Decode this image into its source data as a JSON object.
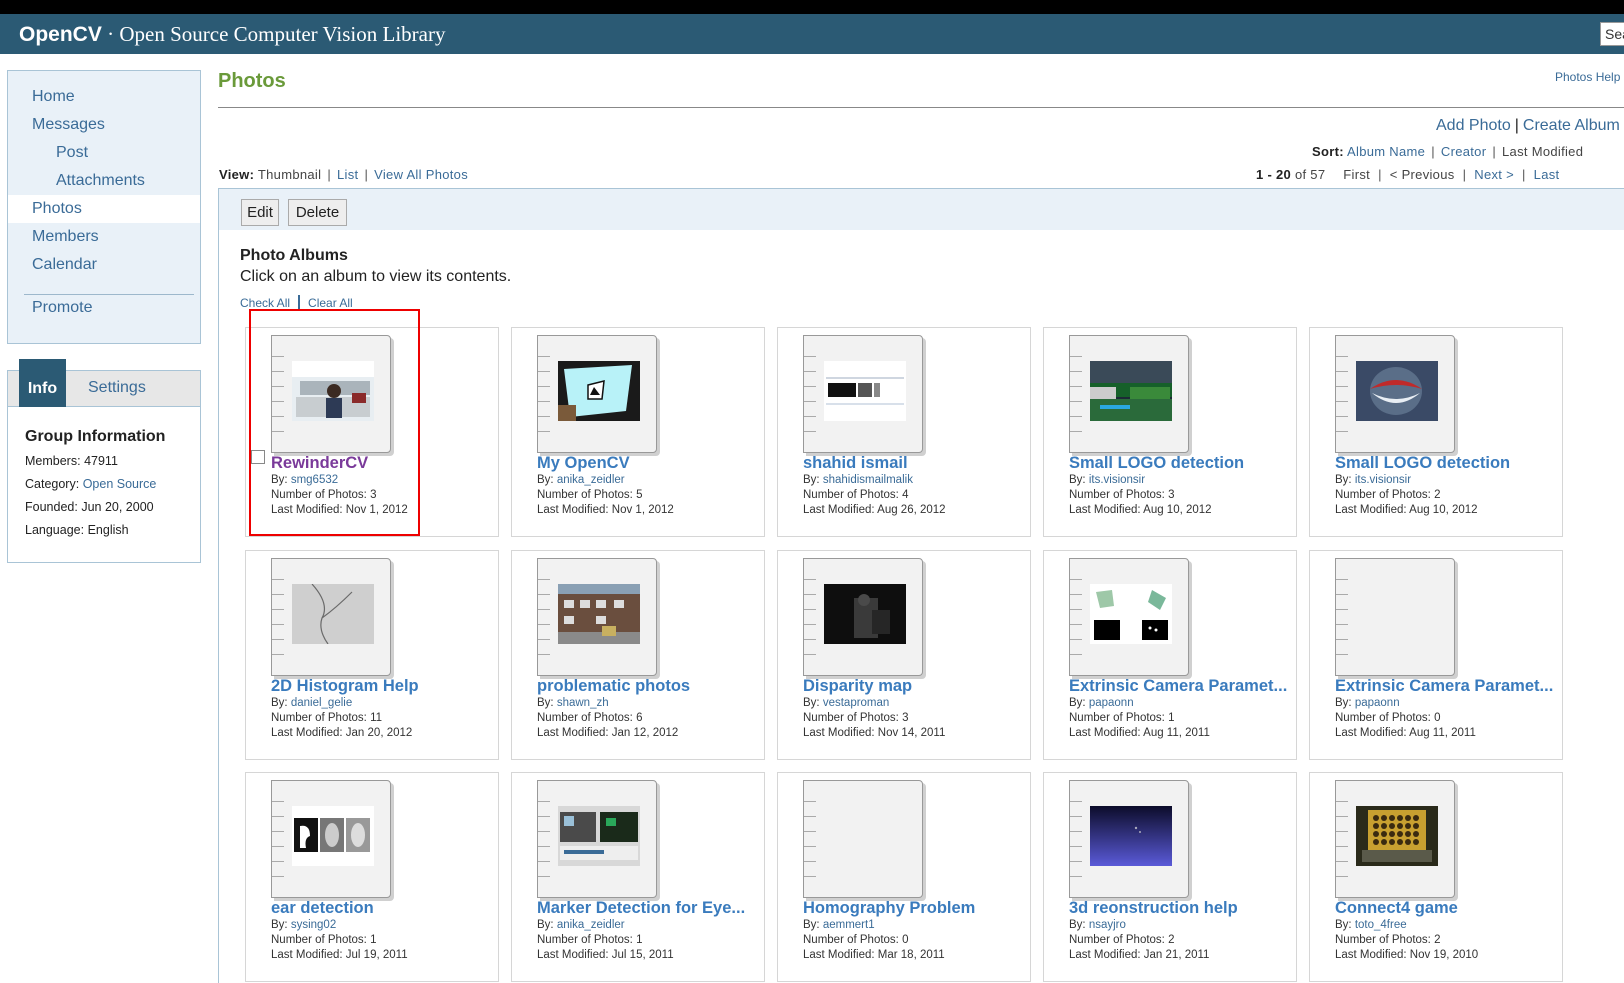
{
  "header": {
    "logo_bold": "OpenCV",
    "logo_rest": " · Open Source Computer Vision Library",
    "search_text": "Sea"
  },
  "sidebar": {
    "items": [
      {
        "label": "Home"
      },
      {
        "label": "Messages"
      },
      {
        "label": "Post"
      },
      {
        "label": "Attachments"
      },
      {
        "label": "Photos"
      },
      {
        "label": "Members"
      },
      {
        "label": "Calendar"
      },
      {
        "label": "Promote"
      }
    ]
  },
  "info": {
    "tab_info": "Info",
    "tab_settings": "Settings",
    "title": "Group Information",
    "members_label": "Members:",
    "members": "47911",
    "category_label": "Category:",
    "category": "Open Source",
    "founded_label": "Founded:",
    "founded": "Jun 20, 2000",
    "language_label": "Language:",
    "language": "English"
  },
  "main": {
    "title": "Photos",
    "help": "Photos Help",
    "add_photo": "Add Photo",
    "create_album": "Create Album",
    "sort_label": "Sort:",
    "sort_album_name": "Album Name",
    "sort_creator": "Creator",
    "sort_last_modified": "Last Modified",
    "view_label": "View:",
    "view_thumbnail": "Thumbnail",
    "view_list": "List",
    "view_all": "View All Photos",
    "pager_range": "1 - 20",
    "pager_of": " of 57",
    "pager_first": "First",
    "pager_prev": "< Previous",
    "pager_next": "Next >",
    "pager_last": "Last",
    "edit": "Edit",
    "delete": "Delete",
    "albums_title": "Photo Albums",
    "albums_desc": "Click on an album to view its contents.",
    "check_all": "Check All",
    "clear_all": "Clear All"
  },
  "albums": [
    {
      "title": "RewinderCV",
      "by": "smg6532",
      "photos": "Number of Photos: 3",
      "modified": "Last Modified: Nov 1, 2012"
    },
    {
      "title": "My OpenCV",
      "by": "anika_zeidler",
      "photos": "Number of Photos: 5",
      "modified": "Last Modified: Nov 1, 2012"
    },
    {
      "title": "shahid ismail",
      "by": "shahidismailmalik",
      "photos": "Number of Photos: 4",
      "modified": "Last Modified: Aug 26, 2012"
    },
    {
      "title": "Small LOGO detection",
      "by": "its.visionsir",
      "photos": "Number of Photos: 3",
      "modified": "Last Modified: Aug 10, 2012"
    },
    {
      "title": "Small LOGO detection",
      "by": "its.visionsir",
      "photos": "Number of Photos: 2",
      "modified": "Last Modified: Aug 10, 2012"
    },
    {
      "title": "2D Histogram Help",
      "by": "daniel_gelie",
      "photos": "Number of Photos: 11",
      "modified": "Last Modified: Jan 20, 2012"
    },
    {
      "title": "problematic photos",
      "by": "shawn_zh",
      "photos": "Number of Photos: 6",
      "modified": "Last Modified: Jan 12, 2012"
    },
    {
      "title": "Disparity map",
      "by": "vestaproman",
      "photos": "Number of Photos: 3",
      "modified": "Last Modified: Nov 14, 2011"
    },
    {
      "title": "Extrinsic Camera Paramet...",
      "by": "papaonn",
      "photos": "Number of Photos: 1",
      "modified": "Last Modified: Aug 11, 2011"
    },
    {
      "title": "Extrinsic Camera Paramet...",
      "by": "papaonn",
      "photos": "Number of Photos: 0",
      "modified": "Last Modified: Aug 11, 2011"
    },
    {
      "title": "ear detection",
      "by": "sysing02",
      "photos": "Number of Photos: 1",
      "modified": "Last Modified: Jul 19, 2011"
    },
    {
      "title": "Marker Detection for Eye...",
      "by": "anika_zeidler",
      "photos": "Number of Photos: 1",
      "modified": "Last Modified: Jul 15, 2011"
    },
    {
      "title": "Homography Problem",
      "by": "aemmert1",
      "photos": "Number of Photos: 0",
      "modified": "Last Modified: Mar 18, 2011"
    },
    {
      "title": "3d reonstruction help",
      "by": "nsayjro",
      "photos": "Number of Photos: 2",
      "modified": "Last Modified: Jan 21, 2011"
    },
    {
      "title": "Connect4 game",
      "by": "toto_4free",
      "photos": "Number of Photos: 2",
      "modified": "Last Modified: Nov 19, 2010"
    }
  ],
  "by_label": "By:"
}
